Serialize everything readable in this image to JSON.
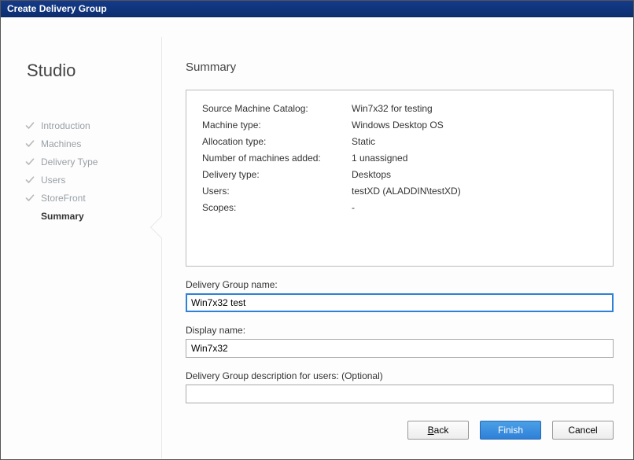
{
  "window": {
    "title": "Create Delivery Group"
  },
  "sidebar": {
    "title": "Studio",
    "steps": [
      {
        "label": "Introduction",
        "done": true,
        "current": false
      },
      {
        "label": "Machines",
        "done": true,
        "current": false
      },
      {
        "label": "Delivery Type",
        "done": true,
        "current": false
      },
      {
        "label": "Users",
        "done": true,
        "current": false
      },
      {
        "label": "StoreFront",
        "done": true,
        "current": false
      },
      {
        "label": "Summary",
        "done": false,
        "current": true
      }
    ]
  },
  "main": {
    "header": "Summary",
    "summary_rows": [
      {
        "label": "Source Machine Catalog:",
        "value": "Win7x32 for testing"
      },
      {
        "label": "Machine type:",
        "value": "Windows Desktop OS"
      },
      {
        "label": "Allocation type:",
        "value": "Static"
      },
      {
        "label": "Number of machines added:",
        "value": "1 unassigned"
      },
      {
        "label": "Delivery type:",
        "value": "Desktops"
      },
      {
        "label": "Users:",
        "value": "testXD (ALADDIN\\testXD)"
      },
      {
        "label": "Scopes:",
        "value": "-"
      }
    ],
    "fields": {
      "group_name_label": "Delivery Group name:",
      "group_name_value": "Win7x32 test",
      "display_name_label": "Display name:",
      "display_name_value": "Win7x32",
      "description_label": "Delivery Group description for users: (Optional)",
      "description_value": ""
    }
  },
  "buttons": {
    "back": {
      "pre": "",
      "key": "B",
      "post": "ack"
    },
    "finish": {
      "label": "Finish"
    },
    "cancel": {
      "label": "Cancel"
    }
  }
}
